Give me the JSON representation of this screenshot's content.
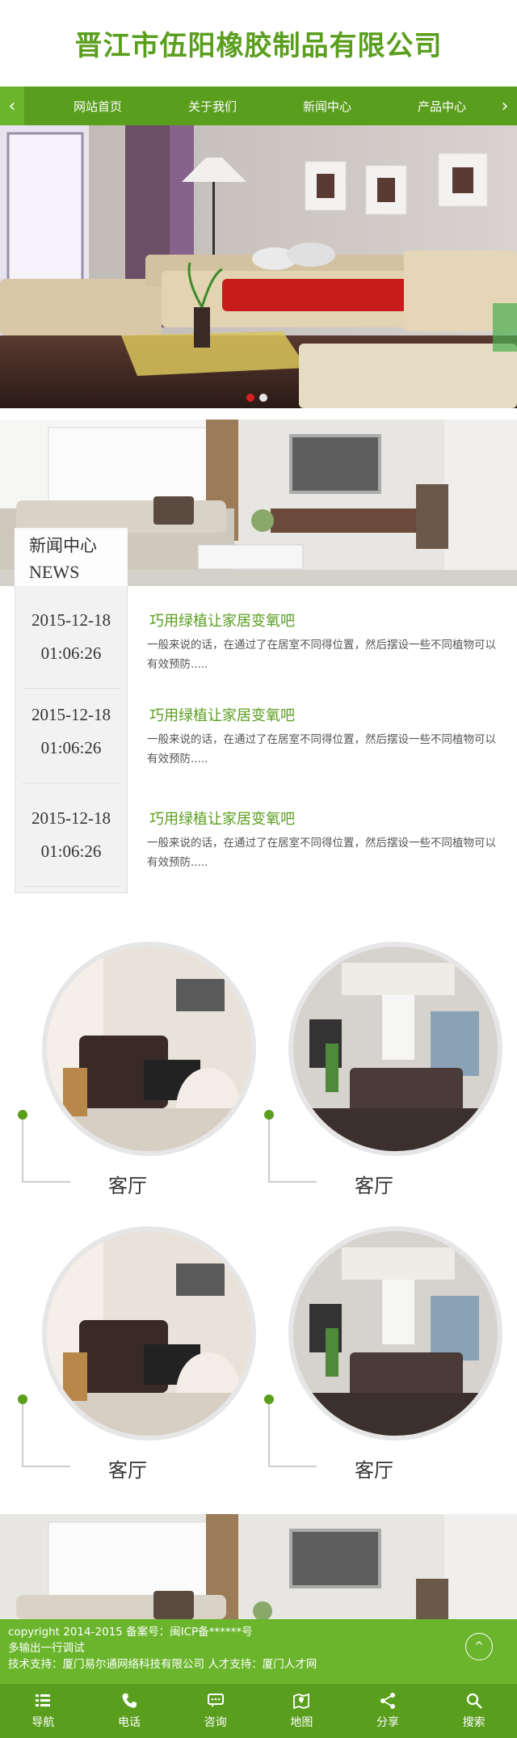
{
  "header": {
    "company_name": "晋江市伍阳橡胶制品有限公司"
  },
  "nav": {
    "prev_icon": "‹",
    "next_icon": "›",
    "items": [
      "网站首页",
      "关于我们",
      "新闻中心",
      "产品中心"
    ]
  },
  "news": {
    "title_cn": "新闻中心",
    "title_en": "NEWS",
    "items": [
      {
        "date": "2015-12-18",
        "time": "01:06:26",
        "title": "巧用绿植让家居变氧吧",
        "summary": "一般来说的话，在通过了在居室不同得位置，然后摆设一些不同植物可以有效预防....."
      },
      {
        "date": "2015-12-18",
        "time": "01:06:26",
        "title": "巧用绿植让家居变氧吧",
        "summary": "一般来说的话，在通过了在居室不同得位置，然后摆设一些不同植物可以有效预防....."
      },
      {
        "date": "2015-12-18",
        "time": "01:06:26",
        "title": "巧用绿植让家居变氧吧",
        "summary": "一般来说的话，在通过了在居室不同得位置，然后摆设一些不同植物可以有效预防....."
      }
    ]
  },
  "cases": [
    {
      "label": "客厅"
    },
    {
      "label": "客厅"
    },
    {
      "label": "客厅"
    },
    {
      "label": "客厅"
    }
  ],
  "footer": {
    "line1": "copyright 2014-2015 备案号：闽ICP备******号",
    "line2": "多输出一行调试",
    "line3": "技术支持：厦门易尔通网络科技有限公司 人才支持：厦门人才网",
    "top_icon": "^"
  },
  "bottom_nav": [
    "导航",
    "电话",
    "咨询",
    "地图",
    "分享",
    "搜索"
  ],
  "colors": {
    "brand_green": "#5a9e1e",
    "light_green": "#6ab52c",
    "active_dot": "#d42020"
  }
}
